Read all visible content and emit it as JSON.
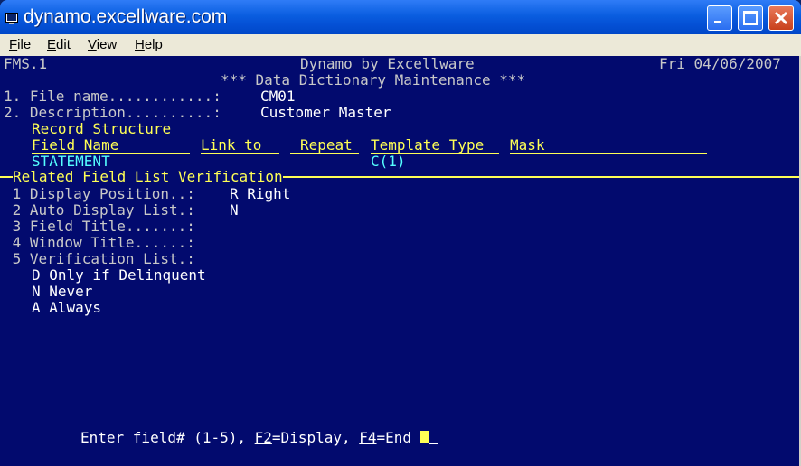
{
  "window": {
    "title": "dynamo.excellware.com"
  },
  "menubar": {
    "items": [
      {
        "accel": "F",
        "rest": "ile"
      },
      {
        "accel": "E",
        "rest": "dit"
      },
      {
        "accel": "V",
        "rest": "iew"
      },
      {
        "accel": "H",
        "rest": "elp"
      }
    ]
  },
  "header": {
    "program": "FMS.1",
    "app_name": "Dynamo by Excellware",
    "date": "Fri 04/06/2007",
    "subtitle": "*** Data Dictionary Maintenance ***"
  },
  "fields": {
    "f1_label": "1. File name............:",
    "f1_value": "CM01",
    "f2_label": "2. Description..........:",
    "f2_value": "Customer Master"
  },
  "record_structure": {
    "heading": "Record Structure",
    "columns": [
      "Field Name",
      "Link to",
      "Repeat",
      "Template Type",
      "Mask"
    ],
    "row": {
      "field_name": "STATEMENT",
      "template_type": "C(1)"
    }
  },
  "verification": {
    "title": "Related Field List Verification",
    "items": [
      {
        "label": " 1 Display Position..:",
        "value": "R Right"
      },
      {
        "label": " 2 Auto Display List.:",
        "value": "N"
      },
      {
        "label": " 3 Field Title.......:",
        "value": ""
      },
      {
        "label": " 4 Window Title......:",
        "value": ""
      },
      {
        "label": " 5 Verification List.:",
        "value": ""
      }
    ],
    "options": [
      "D Only if Delinquent",
      "N Never",
      "A Always"
    ]
  },
  "prompt": {
    "lead": "Enter field# (1-5), ",
    "f2_key": "F2",
    "f2_text": "=Display, ",
    "f4_key": "F4",
    "f4_text": "=End "
  }
}
